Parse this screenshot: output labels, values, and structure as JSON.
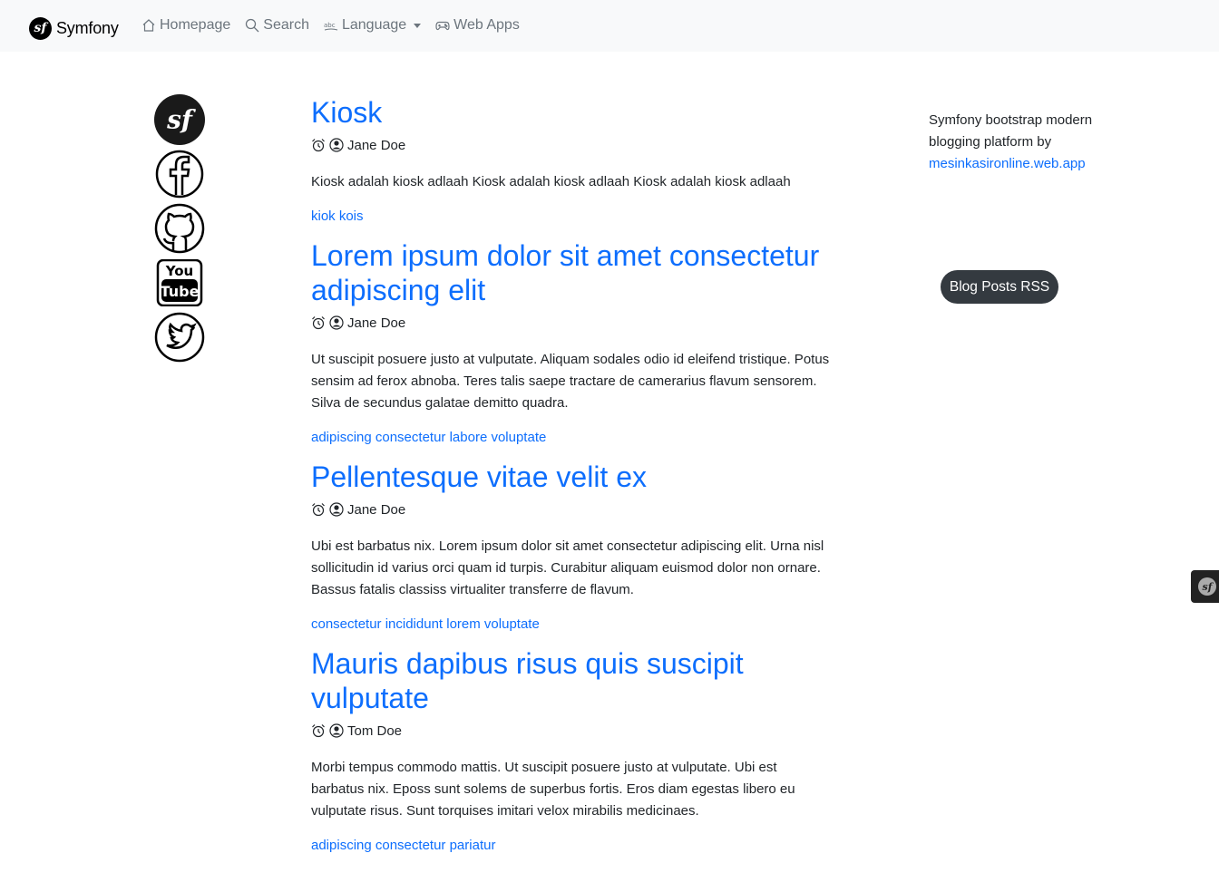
{
  "navbar": {
    "brand": "Symfony",
    "logo_glyph": "sf",
    "items": [
      {
        "label": "Homepage",
        "icon": "home-icon"
      },
      {
        "label": "Search",
        "icon": "search-icon"
      },
      {
        "label": "Language",
        "icon": "language-icon"
      },
      {
        "label": "Web Apps",
        "icon": "gamepad-icon"
      }
    ]
  },
  "social": [
    {
      "name": "symfony-icon",
      "glyph": "sf"
    },
    {
      "name": "facebook-icon"
    },
    {
      "name": "github-icon"
    },
    {
      "name": "youtube-icon",
      "line1": "You",
      "line2": "Tube"
    },
    {
      "name": "twitter-icon"
    }
  ],
  "posts": [
    {
      "title": "Kiosk",
      "author": "Jane Doe",
      "summary": "Kiosk adalah kiosk adlaah Kiosk adalah kiosk adlaah Kiosk adalah kiosk adlaah",
      "tags": "kiok kois"
    },
    {
      "title": "Lorem ipsum dolor sit amet consectetur adipiscing elit",
      "author": "Jane Doe",
      "summary": "Ut suscipit posuere justo at vulputate. Aliquam sodales odio id eleifend tristique. Potus sensim ad ferox abnoba. Teres talis saepe tractare de camerarius flavum sensorem. Silva de secundus galatae demitto quadra.",
      "tags": "adipiscing consectetur labore voluptate"
    },
    {
      "title": "Pellentesque vitae velit ex",
      "author": "Jane Doe",
      "summary": "Ubi est barbatus nix. Lorem ipsum dolor sit amet consectetur adipiscing elit. Urna nisl sollicitudin id varius orci quam id turpis. Curabitur aliquam euismod dolor non ornare. Bassus fatalis classiss virtualiter transferre de flavum.",
      "tags": "consectetur incididunt lorem voluptate"
    },
    {
      "title": "Mauris dapibus risus quis suscipit vulputate",
      "author": "Tom Doe",
      "summary": "Morbi tempus commodo mattis. Ut suscipit posuere justo at vulputate. Ubi est barbatus nix. Eposs sunt solems de superbus fortis. Eros diam egestas libero eu vulputate risus. Sunt torquises imitari velox mirabilis medicinaes.",
      "tags": "adipiscing consectetur pariatur"
    }
  ],
  "sidebar": {
    "about_text": "Symfony bootstrap modern blogging platform by",
    "about_link": "mesinkasironline.web.app",
    "rss_button": "Blog Posts RSS"
  },
  "debug_toolbar": {
    "glyph": "sf"
  },
  "colors": {
    "link": "#0d6efd",
    "navbar_bg": "#f8f9fa",
    "nav_text": "#6c757d",
    "button_dark": "#343a40"
  }
}
